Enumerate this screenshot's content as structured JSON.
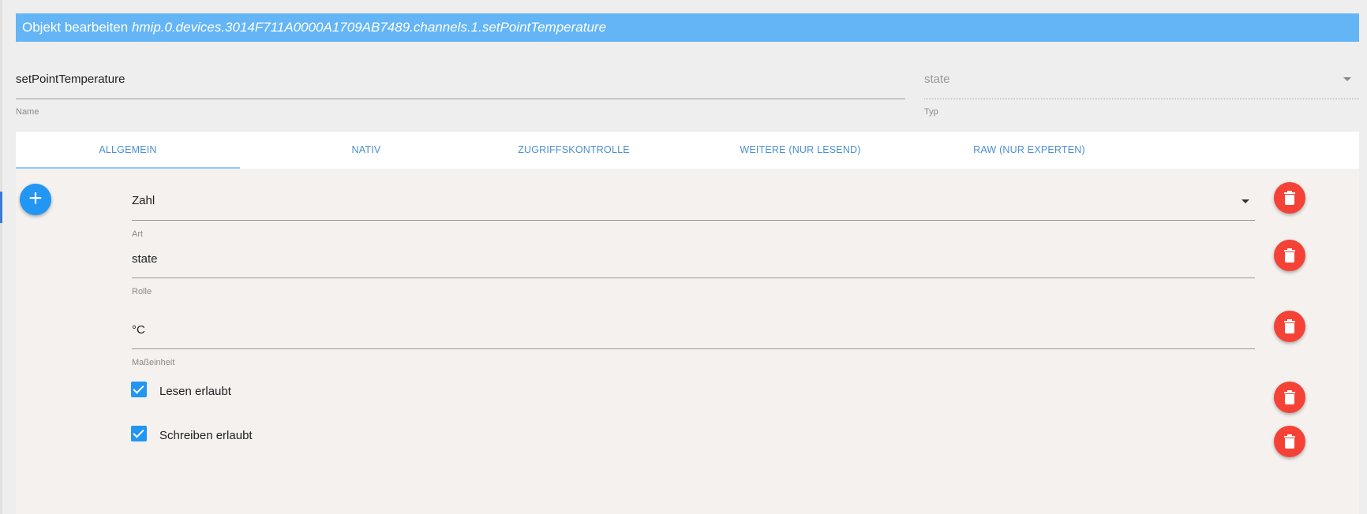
{
  "dialog": {
    "title_prefix": "Objekt bearbeiten",
    "object_path": "hmip.0.devices.3014F711A0000A1709AB7489.channels.1.setPointTemperature"
  },
  "name_field": {
    "value": "setPointTemperature",
    "label": "Name"
  },
  "type_field": {
    "value": "state",
    "label": "Typ"
  },
  "tabs": [
    {
      "label": "ALLGEMEIN",
      "active": true
    },
    {
      "label": "NATIV",
      "active": false
    },
    {
      "label": "ZUGRIFFSKONTROLLE",
      "active": false
    },
    {
      "label": "WEITERE (NUR LESEND)",
      "active": false
    },
    {
      "label": "RAW (NUR EXPERTEN)",
      "active": false
    }
  ],
  "general": {
    "art": {
      "value": "Zahl",
      "label": "Art"
    },
    "rolle": {
      "value": "state",
      "label": "Rolle"
    },
    "unit": {
      "value": "°C",
      "label": "Maßeinheit"
    },
    "read": {
      "label": "Lesen erlaubt",
      "checked": true
    },
    "write": {
      "label": "Schreiben erlaubt",
      "checked": true
    }
  },
  "icons": {
    "add": "plus-icon",
    "delete": "trash-icon",
    "dropdown": "caret-down-icon",
    "check": "checkmark-icon"
  },
  "colors": {
    "title_bar": "#64b5f6",
    "tab_text": "#4a90d0",
    "add_button": "#2196f3",
    "delete_button": "#f44336",
    "checkbox": "#2196f3"
  }
}
